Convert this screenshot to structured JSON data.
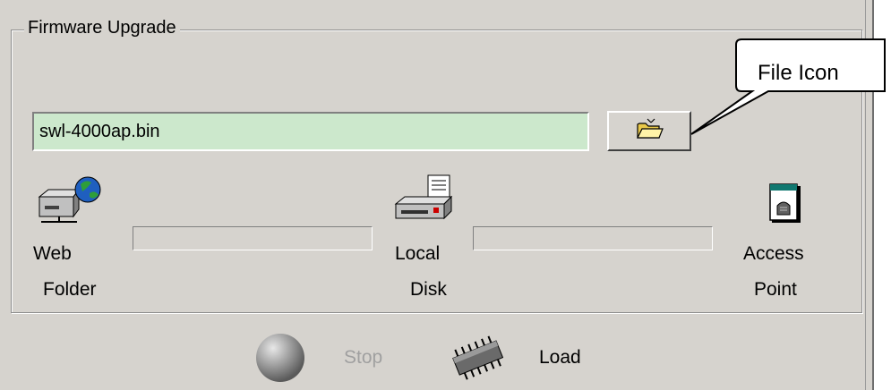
{
  "group": {
    "title": "Firmware Upgrade"
  },
  "file": {
    "value": "swl-4000ap.bin"
  },
  "callout": {
    "label": "File Icon"
  },
  "locations": {
    "web_folder": {
      "line1": "Web",
      "line2": "Folder",
      "icon": "web-folder-icon"
    },
    "local_disk": {
      "line1": "Local",
      "line2": "Disk",
      "icon": "local-disk-icon"
    },
    "access_point": {
      "line1": "Access",
      "line2": "Point",
      "icon": "access-point-icon"
    }
  },
  "progress": {
    "web_to_disk": 0,
    "disk_to_ap": 0
  },
  "controls": {
    "stop_label": "Stop",
    "load_label": "Load"
  },
  "colors": {
    "panel": "#d6d3ce",
    "input_bg": "#cce8cc",
    "stop_text": "#a0a0a0"
  }
}
